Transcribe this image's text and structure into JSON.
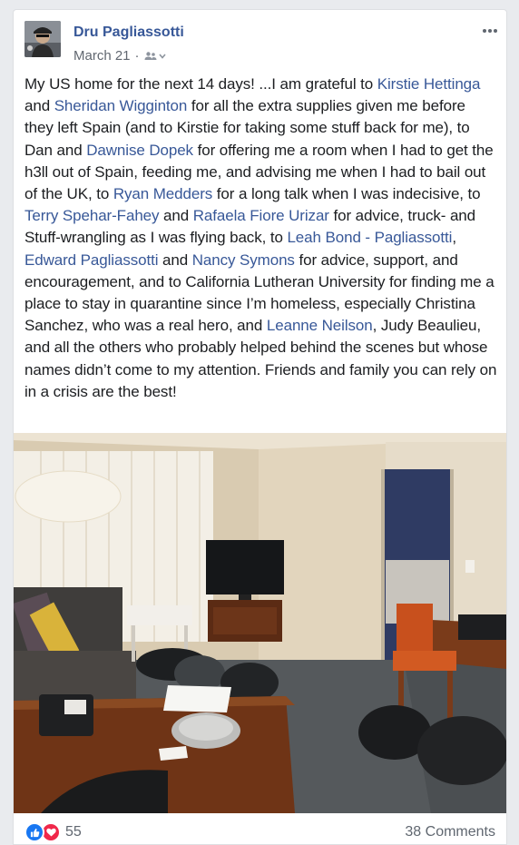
{
  "post": {
    "author": "Dru Pagliassotti",
    "date": "March 21",
    "separator": "·",
    "avatar_icon": "profile-photo",
    "audience_icon": "friends-icon",
    "menu_icon": "more-options-icon",
    "body": {
      "t1": "My US home for the next 14 days! ...I am grateful to ",
      "m1": "Kirstie Hettinga",
      "t2": " and ",
      "m2": "Sheridan Wigginton",
      "t3": " for all the extra supplies given me before they left Spain (and to Kirstie for taking some stuff back for me), to Dan and ",
      "m3": "Dawnise Dopek",
      "t4": " for offering me a room when I had to get the h3ll out of Spain, feeding me, and advising me when I had to bail out of the UK, to ",
      "m4": "Ryan Medders",
      "t5": " for a long talk when I was indecisive, to ",
      "m5": "Terry Spehar-Fahey",
      "t6": " and ",
      "m6": "Rafaela Fiore Urizar",
      "t7": " for advice, truck- and Stuff-wrangling as I was flying back, to ",
      "m7": "Leah Bond - Pagliassotti",
      "t8": ", ",
      "m8": "Edward Pagliassotti",
      "t9": " and ",
      "m9": "Nancy Symons",
      "t10": " for advice, support, and encouragement, and to California Lutheran University for finding me a place to stay in quarantine since I’m homeless, especially Christina Sanchez, who was a real hero, and ",
      "m10": "Leanne Neilson",
      "t11": ", Judy Beaulieu, and all the others who probably helped behind the scenes but whose names didn’t come to my attention. Friends and family you can rely on in a crisis are the best!"
    },
    "photo_icon": "hotel-room-photo",
    "reaction_icons": [
      "like-reaction-icon",
      "love-reaction-icon"
    ],
    "reaction_count": "55",
    "comments_label": "38 Comments",
    "colors": {
      "link": "#385898",
      "like": "#1877f2",
      "love": "#f0284a",
      "text": "#1c1e21",
      "meta": "#616770"
    }
  }
}
